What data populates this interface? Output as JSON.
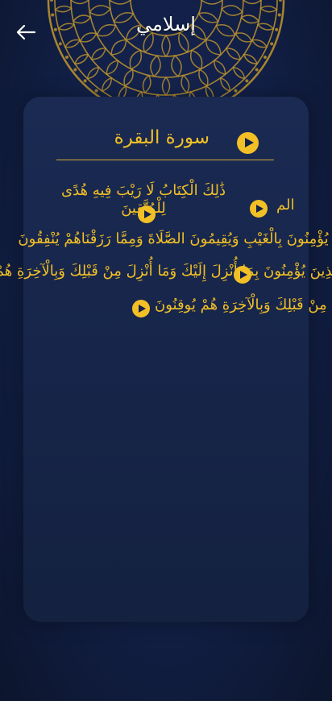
{
  "header": {
    "title": "إسلامي",
    "back_icon": "arrow-left-icon"
  },
  "surah": {
    "name": "سورة البقرة",
    "play_icon": "play-icon"
  },
  "verses": [
    "الم",
    "ذَٰلِكَ الْكِتَابُ لَا رَيْبَ فِيهِ هُدًى لِلْمُتَّقِينَ",
    "الَّذِينَ يُؤْمِنُونَ بِالْغَيْبِ وَيُقِيمُونَ الصَّلَاةَ وَمِمَّا رَزَقْنَاهُمْ يُنْفِقُونَ",
    "وَالَّذِينَ يُؤْمِنُونَ بِمَا أُنْزِلَ إِلَيْكَ وَمَا أُنْزِلَ مِنْ قَبْلِكَ وَبِالْآخِرَةِ هُمْ يُوقِنُونَ"
  ],
  "colors": {
    "accent": "#f2c026",
    "background": "#13214a",
    "card": "#1a2a52",
    "ornament": "#b8912f"
  }
}
